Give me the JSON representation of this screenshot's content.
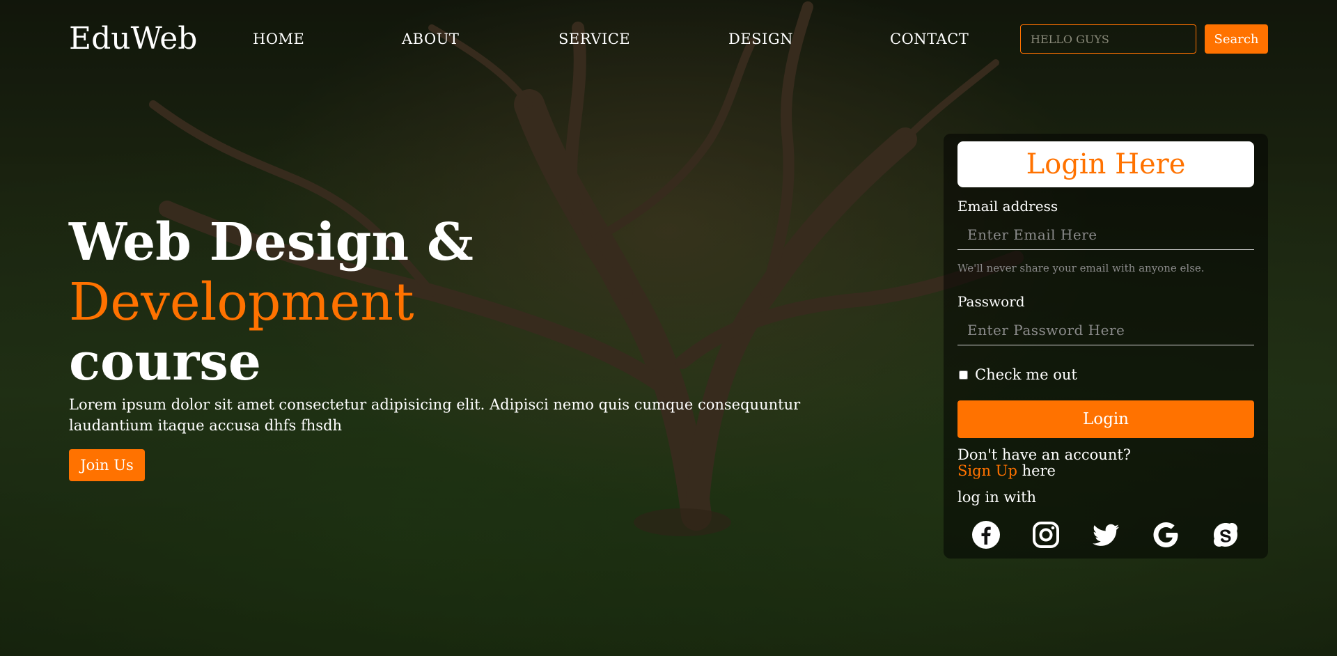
{
  "navbar": {
    "logo": "EduWeb",
    "links": [
      "HOME",
      "ABOUT",
      "SERVICE",
      "DESIGN",
      "CONTACT"
    ],
    "search_placeholder": "HELLO GUYS",
    "search_button": "Search"
  },
  "hero": {
    "title_line1": "Web Design &",
    "title_line2": "Development",
    "title_line3": "course",
    "description": "Lorem ipsum dolor sit amet consectetur adipisicing elit. Adipisci nemo quis cumque consequuntur laudantium itaque accusa dhfs fhsdh",
    "join_button": "Join Us"
  },
  "login": {
    "title": "Login Here",
    "email_label": "Email address",
    "email_placeholder": "Enter Email Here",
    "email_help": "We'll never share your email with anyone else.",
    "password_label": "Password",
    "password_placeholder": "Enter Password Here",
    "checkbox_label": "Check me out",
    "login_button": "Login",
    "no_account_text": "Don't have an account?",
    "signup_link": "Sign Up",
    "signup_suffix": " here",
    "login_with": "log in with",
    "social_icons": [
      "facebook-icon",
      "instagram-icon",
      "twitter-icon",
      "google-icon",
      "skype-icon"
    ]
  },
  "colors": {
    "accent": "#ff7200",
    "text": "#ffffff",
    "card_bg": "rgba(0,0,0,0.5)"
  }
}
